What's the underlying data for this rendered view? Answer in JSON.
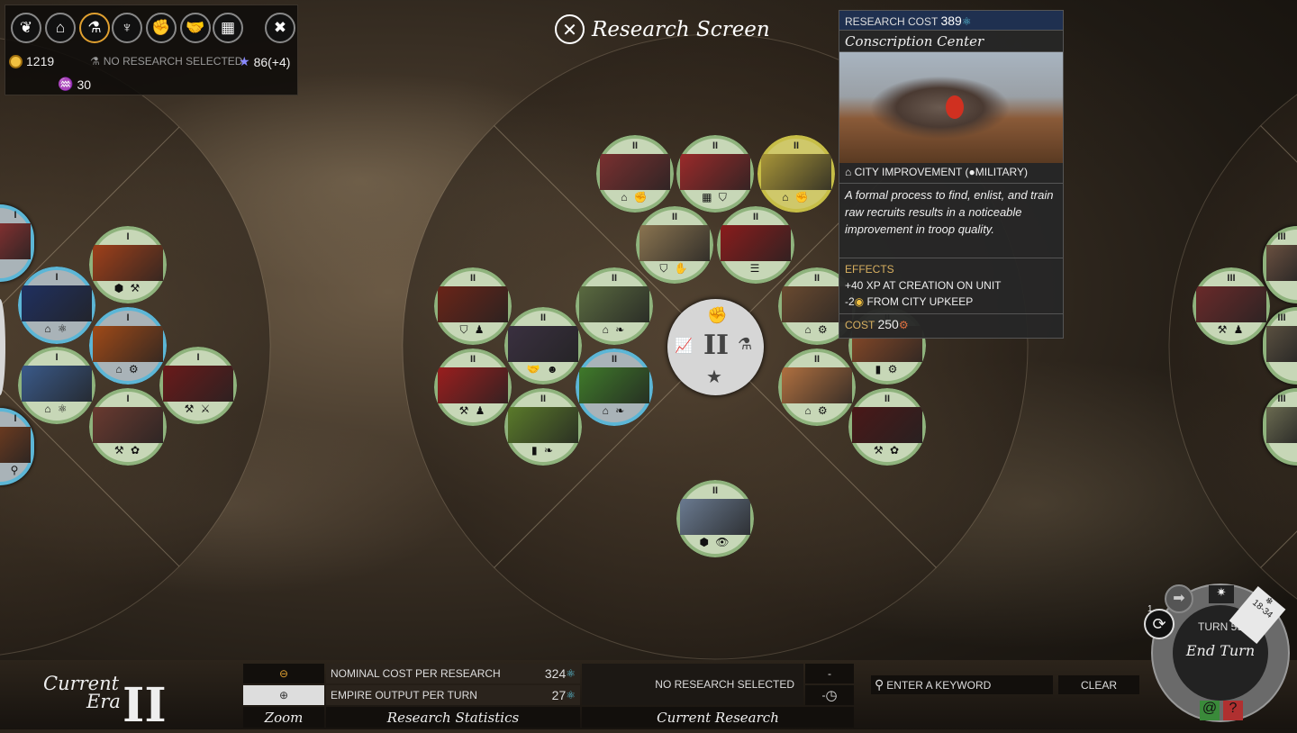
{
  "hud": {
    "tabs": [
      {
        "name": "laurel-icon",
        "glyph": "❦"
      },
      {
        "name": "capitol-icon",
        "glyph": "⌂"
      },
      {
        "name": "research-flask-icon",
        "glyph": "⚗",
        "active": true
      },
      {
        "name": "grail-icon",
        "glyph": "♆"
      },
      {
        "name": "fist-icon",
        "glyph": "✊"
      },
      {
        "name": "handshake-icon",
        "glyph": "🤝"
      },
      {
        "name": "market-icon",
        "glyph": "▦"
      }
    ],
    "settings_glyph": "✖",
    "dust": "1219",
    "research_status": "NO RESEARCH SELECTED",
    "influence": "86(+4)",
    "strategic": "30"
  },
  "title": "Research Screen",
  "tooltip": {
    "research_cost_label": "RESEARCH COST",
    "research_cost": "389",
    "name": "Conscription Center",
    "category": "CITY IMPROVEMENT (",
    "category_tag": "MILITARY)",
    "description": "A formal process to find, enlist, and train raw recruits results in a noticeable improvement in troop quality.",
    "effects_label": "EFFECTS",
    "effects": [
      "+40 XP AT CREATION ON UNIT",
      "FROM CITY UPKEEP"
    ],
    "upkeep_value": "-2",
    "cost_label": "COST",
    "cost": "250"
  },
  "nodes": [
    {
      "tier": "II",
      "state": "green",
      "img": "#7a3030",
      "icons": "⌂ ✊"
    },
    {
      "tier": "II",
      "state": "green",
      "img": "#9a2a2a",
      "icons": "▦ ⛉"
    },
    {
      "tier": "II",
      "state": "yellow",
      "img": "#a89538",
      "icons": "⌂ ✊"
    },
    {
      "tier": "II",
      "state": "green",
      "img": "#8a7450",
      "icons": "⛉ ✋"
    },
    {
      "tier": "II",
      "state": "green",
      "img": "#8a1c1c",
      "icons": "☰"
    },
    {
      "tier": "II",
      "state": "green",
      "img": "#6a2418",
      "icons": "⛉ ♟"
    },
    {
      "tier": "II",
      "state": "green",
      "img": "#5a6a40",
      "icons": "⌂ ❧"
    },
    {
      "tier": "II",
      "state": "green",
      "img": "#3a3040",
      "icons": "🤝 ☻"
    },
    {
      "tier": "II",
      "state": "green",
      "img": "#9a1e1e",
      "icons": "⚒ ♟"
    },
    {
      "tier": "II",
      "state": "blue",
      "img": "#3f7a2a",
      "icons": "⌂ ❧"
    },
    {
      "tier": "II",
      "state": "green",
      "img": "#5a7a2a",
      "icons": "▮ ❧"
    },
    {
      "tier": "II",
      "state": "green",
      "img": "#6a4a30",
      "icons": "⌂ ⚙"
    },
    {
      "tier": "II",
      "state": "green",
      "img": "#8a4a28",
      "icons": "▮ ⚙"
    },
    {
      "tier": "II",
      "state": "green",
      "img": "#b07040",
      "icons": "⌂ ⚙"
    },
    {
      "tier": "II",
      "state": "green",
      "img": "#4a1818",
      "icons": "⚒ ✿"
    },
    {
      "tier": "II",
      "state": "green",
      "img": "#6a7a90",
      "icons": "⬢ 👁"
    },
    {
      "tier": "I",
      "state": "blue",
      "img": "#803030",
      "icons": ""
    },
    {
      "tier": "I",
      "state": "green",
      "img": "#a0401a",
      "icons": "⬢ ⚒"
    },
    {
      "tier": "I",
      "state": "blue",
      "img": "#203060",
      "icons": "⌂ ⚛"
    },
    {
      "tier": "I",
      "state": "blue",
      "img": "#a04a18",
      "icons": "⌂ ⚙"
    },
    {
      "tier": "I",
      "state": "green",
      "img": "#6a1a1a",
      "icons": "⚒ ⚔"
    },
    {
      "tier": "I",
      "state": "green",
      "img": "#3a5a8a",
      "icons": "⌂ ⚛"
    },
    {
      "tier": "I",
      "state": "green",
      "img": "#6a3a30",
      "icons": "⚒ ✿"
    },
    {
      "tier": "I",
      "state": "blue",
      "img": "#6a3a20",
      "icons": "⚲"
    },
    {
      "tier": "III",
      "state": "green",
      "img": "#6a2a2a",
      "icons": "⚒ ♟"
    },
    {
      "tier": "III",
      "state": "green",
      "img": "#6a5040",
      "icons": ""
    },
    {
      "tier": "III",
      "state": "green",
      "img": "#5a5040",
      "icons": ""
    },
    {
      "tier": "III",
      "state": "green",
      "img": "#6a6a50",
      "icons": ""
    }
  ],
  "hub": {
    "tier": "II",
    "top": "✊",
    "left": "📈",
    "right": "⚗",
    "bottom": "★"
  },
  "bottom": {
    "era_label_1": "Current",
    "era_label_2": "Era",
    "era_numeral": "II",
    "zoom_label": "Zoom",
    "stats_label": "Research Statistics",
    "nominal_cost_label": "NOMINAL COST PER RESEARCH",
    "nominal_cost": "324",
    "empire_output_label": "EMPIRE OUTPUT PER TURN",
    "empire_output": "27",
    "current_label": "Current Research",
    "current_status": "NO RESEARCH SELECTED",
    "current_value": "-",
    "current_turns": "-",
    "search_placeholder": "ENTER A KEYWORD",
    "clear_label": "CLEAR"
  },
  "end_turn": {
    "turn": "TURN 59",
    "label": "End Turn",
    "season_timer": "18-34",
    "notifications": "1"
  }
}
